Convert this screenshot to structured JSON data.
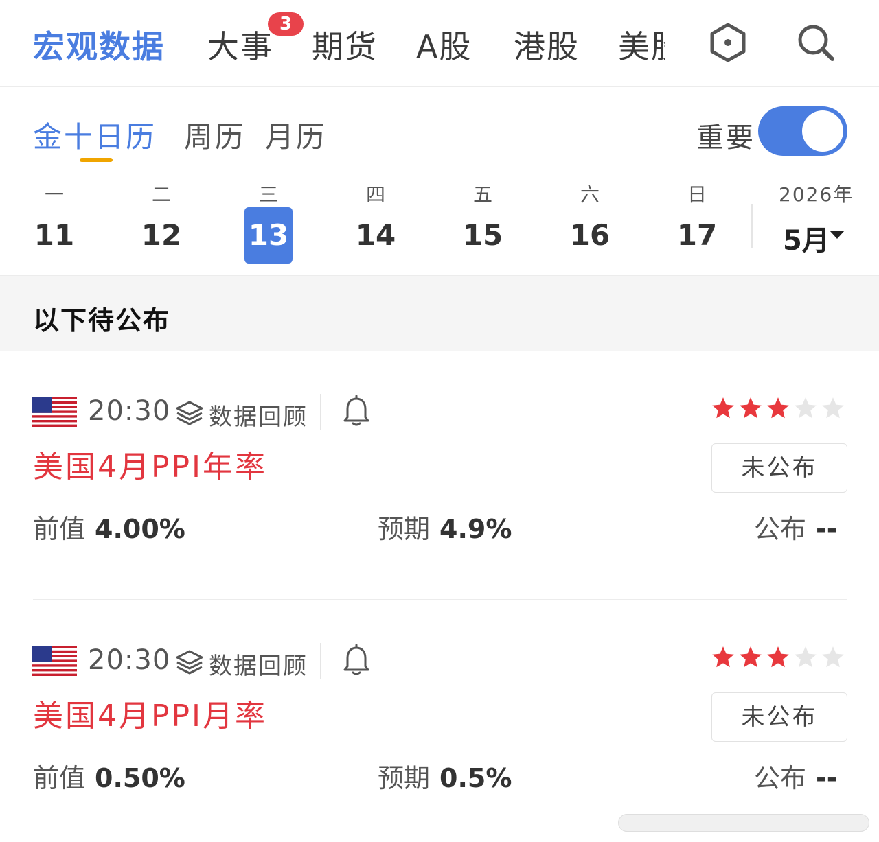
{
  "top_nav": {
    "tabs": [
      "宏观数据",
      "大事",
      "期货",
      "A股",
      "港股",
      "美股"
    ],
    "active_index": 0,
    "badge_count": "3",
    "icons": [
      "hexagon-icon",
      "search-icon"
    ]
  },
  "calendar_tabs": {
    "tabs": [
      "金十日历",
      "周历",
      "月历"
    ],
    "active_index": 0,
    "important_label": "重要",
    "important_on": true
  },
  "week": {
    "weekdays": [
      "一",
      "二",
      "三",
      "四",
      "五",
      "六",
      "日"
    ],
    "days": [
      "11",
      "12",
      "13",
      "14",
      "15",
      "16",
      "17"
    ],
    "selected_index": 2,
    "year_label": "2026年",
    "month_label": "5月"
  },
  "section": {
    "title": "以下待公布"
  },
  "events": [
    {
      "country_flag": "us-flag-icon",
      "time": "20:30",
      "review_label": "数据回顾",
      "stars": 3,
      "star_max": 5,
      "title": "美国4月PPI年率",
      "status": "未公布",
      "prev_label": "前值",
      "prev_value": "4.00%",
      "forecast_label": "预期",
      "forecast_value": "4.9%",
      "actual_label": "公布",
      "actual_value": "--"
    },
    {
      "country_flag": "us-flag-icon",
      "time": "20:30",
      "review_label": "数据回顾",
      "stars": 3,
      "star_max": 5,
      "title": "美国4月PPI月率",
      "status": "未公布",
      "prev_label": "前值",
      "prev_value": "0.50%",
      "forecast_label": "预期",
      "forecast_value": "0.5%",
      "actual_label": "公布",
      "actual_value": "--"
    }
  ],
  "colors": {
    "accent": "#4a7de0",
    "title_red": "#e2363f",
    "star_on": "#e8383d",
    "star_off": "#e6e6e6",
    "underline": "#f0a500"
  }
}
